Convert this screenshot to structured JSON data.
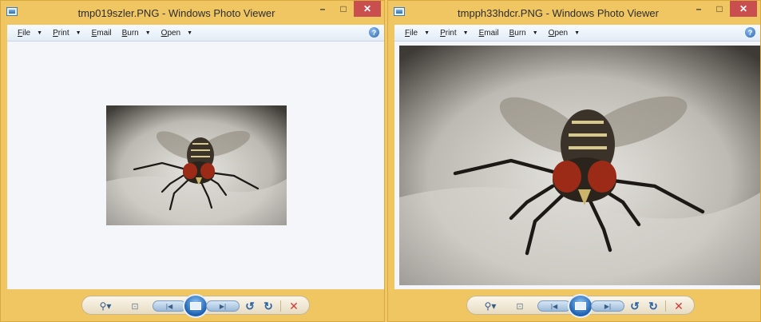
{
  "windows": [
    {
      "title": "tmp019szler.PNG - Windows Photo Viewer",
      "menu": {
        "file": "File",
        "print": "Print",
        "email": "Email",
        "burn": "Burn",
        "open": "Open"
      },
      "help": "?"
    },
    {
      "title": "tmpph33hdcr.PNG - Windows Photo Viewer",
      "menu": {
        "file": "File",
        "print": "Print",
        "email": "Email",
        "burn": "Burn",
        "open": "Open"
      },
      "help": "?"
    }
  ],
  "window_buttons": {
    "minimize": "–",
    "maximize": "□",
    "close": "✕"
  },
  "controls": {
    "zoom": "⚲▾",
    "fit": "⊡",
    "prev": "|◀",
    "next": "▶|",
    "rotate_left": "↺",
    "rotate_right": "↻",
    "delete": "✕"
  },
  "icons": [
    "app-icon",
    "help-icon",
    "zoom-icon",
    "actual-size-icon",
    "previous-icon",
    "slideshow-icon",
    "next-icon",
    "rotate-counterclockwise-icon",
    "rotate-clockwise-icon",
    "delete-icon"
  ],
  "colors": {
    "frame": "#f0c662",
    "viewport": "#f5f6fa",
    "close": "#c94e4e",
    "accent": "#2d64a8"
  }
}
